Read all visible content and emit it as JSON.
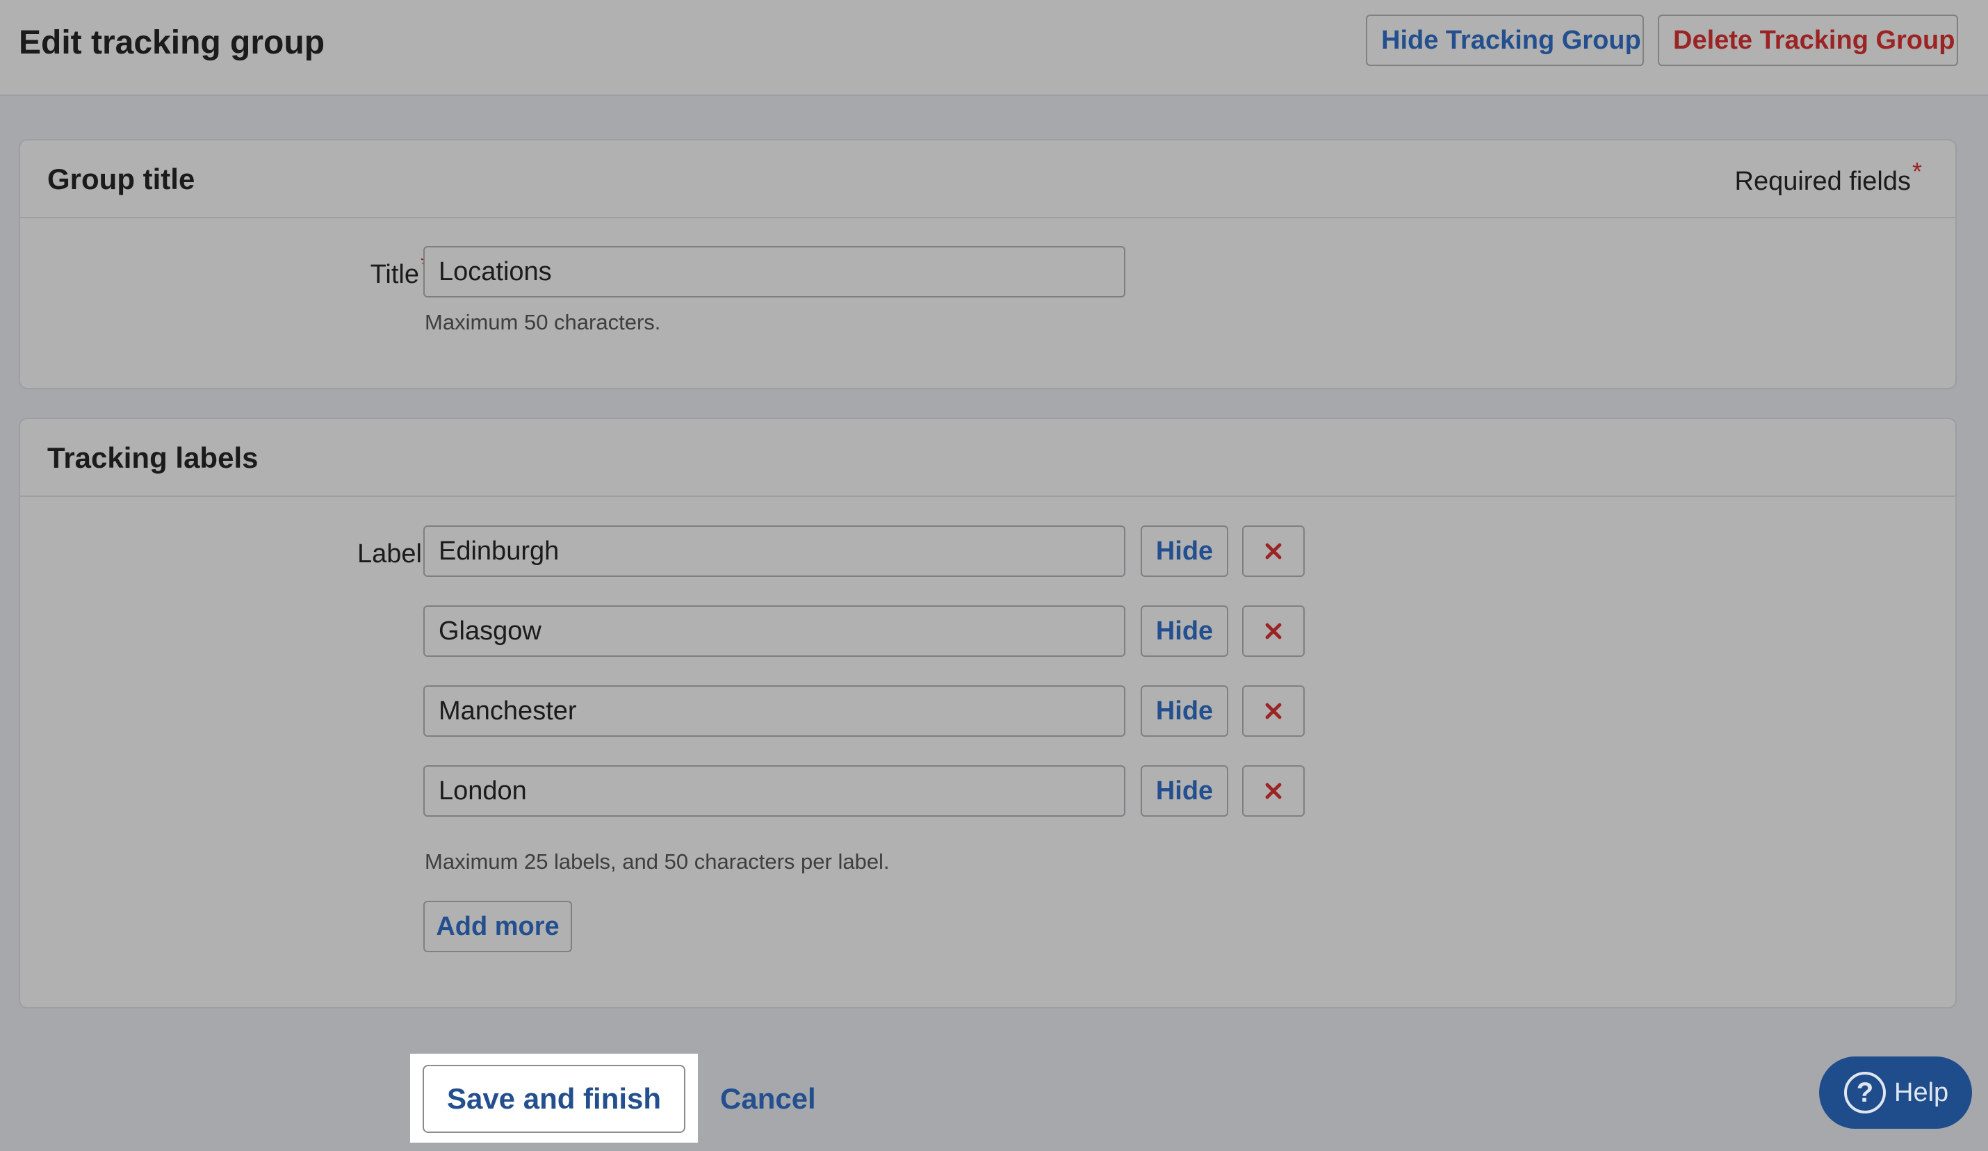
{
  "header": {
    "title": "Edit tracking group",
    "hide_group_label": "Hide Tracking Group",
    "delete_group_label": "Delete Tracking Group"
  },
  "group_title_panel": {
    "heading": "Group title",
    "required_note": "Required fields",
    "required_marker": "*",
    "title_label": "Title",
    "title_value": "Locations",
    "title_hint": "Maximum 50 characters."
  },
  "tracking_labels_panel": {
    "heading": "Tracking labels",
    "label_field_label": "Label",
    "labels": [
      {
        "value": "Edinburgh",
        "hide_label": "Hide"
      },
      {
        "value": "Glasgow",
        "hide_label": "Hide"
      },
      {
        "value": "Manchester",
        "hide_label": "Hide"
      },
      {
        "value": "London",
        "hide_label": "Hide"
      }
    ],
    "labels_hint": "Maximum 25 labels, and 50 characters per label.",
    "add_more_label": "Add more"
  },
  "footer": {
    "save_label": "Save and finish",
    "cancel_label": "Cancel",
    "help_label": "Help",
    "help_icon_glyph": "?"
  },
  "colors": {
    "link_blue": "#244f8e",
    "danger_red": "#9c2323",
    "help_bg": "#1f4c8b"
  },
  "icons": {
    "remove": "close-x-icon",
    "help": "question-circle-icon"
  }
}
